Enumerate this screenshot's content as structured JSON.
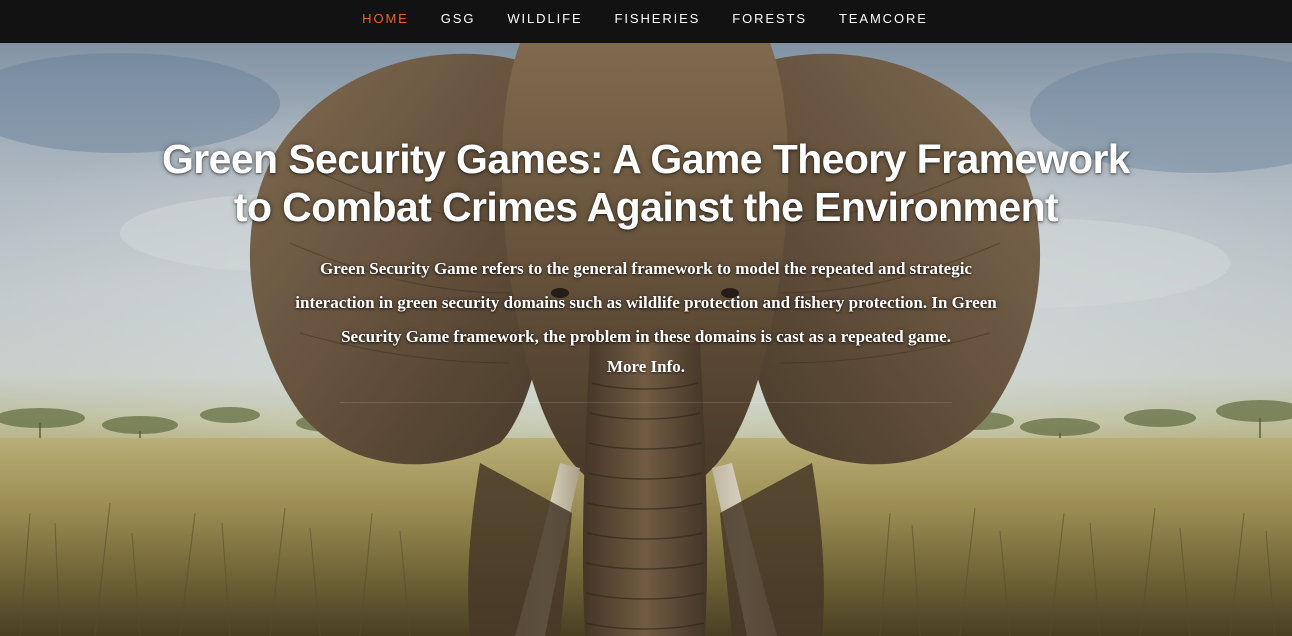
{
  "nav": {
    "items": [
      {
        "label": "HOME",
        "active": true
      },
      {
        "label": "GSG",
        "active": false
      },
      {
        "label": "WILDLIFE",
        "active": false
      },
      {
        "label": "FISHERIES",
        "active": false
      },
      {
        "label": "FORESTS",
        "active": false
      },
      {
        "label": "TEAMCORE",
        "active": false
      }
    ],
    "active_color": "#e8642a",
    "background_color": "#121212"
  },
  "hero": {
    "background_image": "elephant-in-savanna",
    "title_line1": "Green Security Games:  A Game Theory Framework",
    "title_line2": "to Combat Crimes Against the Environment",
    "description": "Green Security Game refers to the general framework to model the repeated and strategic interaction in green security domains such as wildlife protection and fishery protection. In Green Security Game framework, the problem in these domains is cast as a repeated game.",
    "more_info_label": "More Info."
  }
}
